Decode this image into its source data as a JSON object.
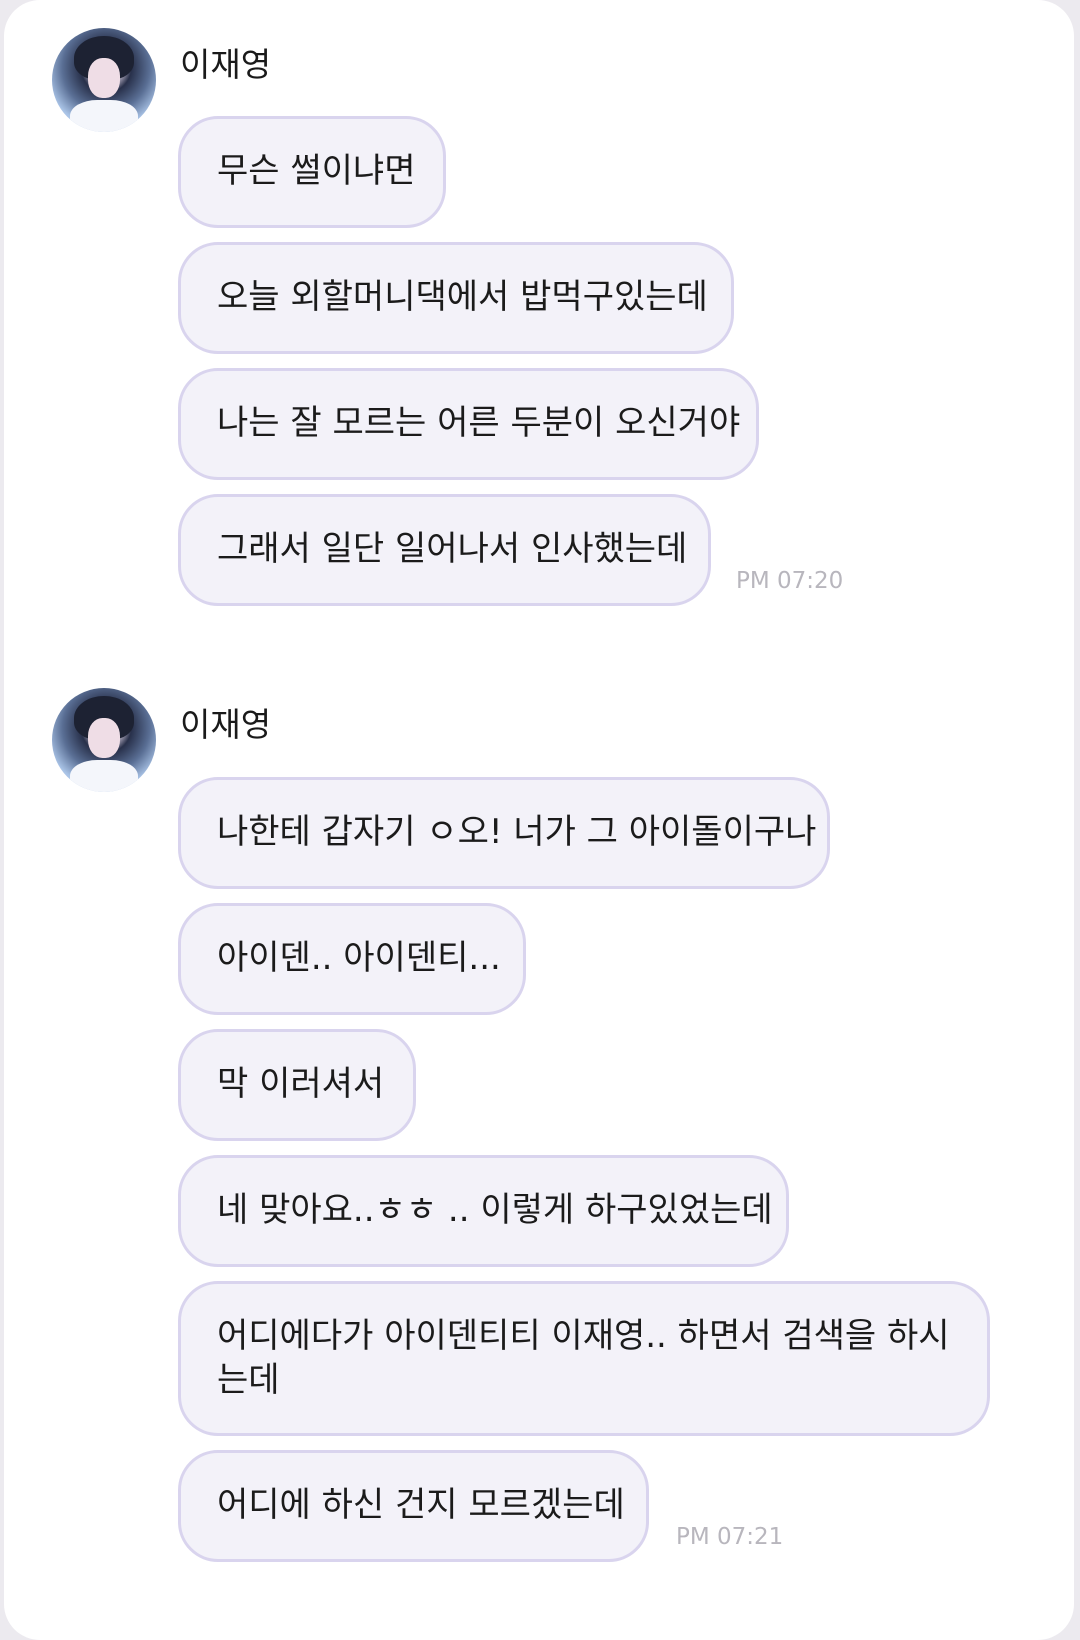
{
  "groups": [
    {
      "sender": "이재영",
      "messages": [
        "무슨 썰이냐면",
        "오늘 외할머니댁에서 밥먹구있는데",
        "나는 잘 모르는 어른 두분이 오신거야",
        "그래서 일단 일어나서 인사했는데"
      ],
      "time": "PM 07:20"
    },
    {
      "sender": "이재영",
      "messages": [
        "나한테 갑자기 ㅇ오! 너가 그 아이돌이구나",
        "아이덴.. 아이덴티...",
        "막 이러셔서",
        "네 맞아요..ㅎㅎ .. 이렇게 하구있었는데",
        "어디에다가 아이덴티티 이재영.. 하면서 검색을 하시는데",
        "어디에 하신 건지 모르겠는데"
      ],
      "time": "PM 07:21"
    }
  ]
}
